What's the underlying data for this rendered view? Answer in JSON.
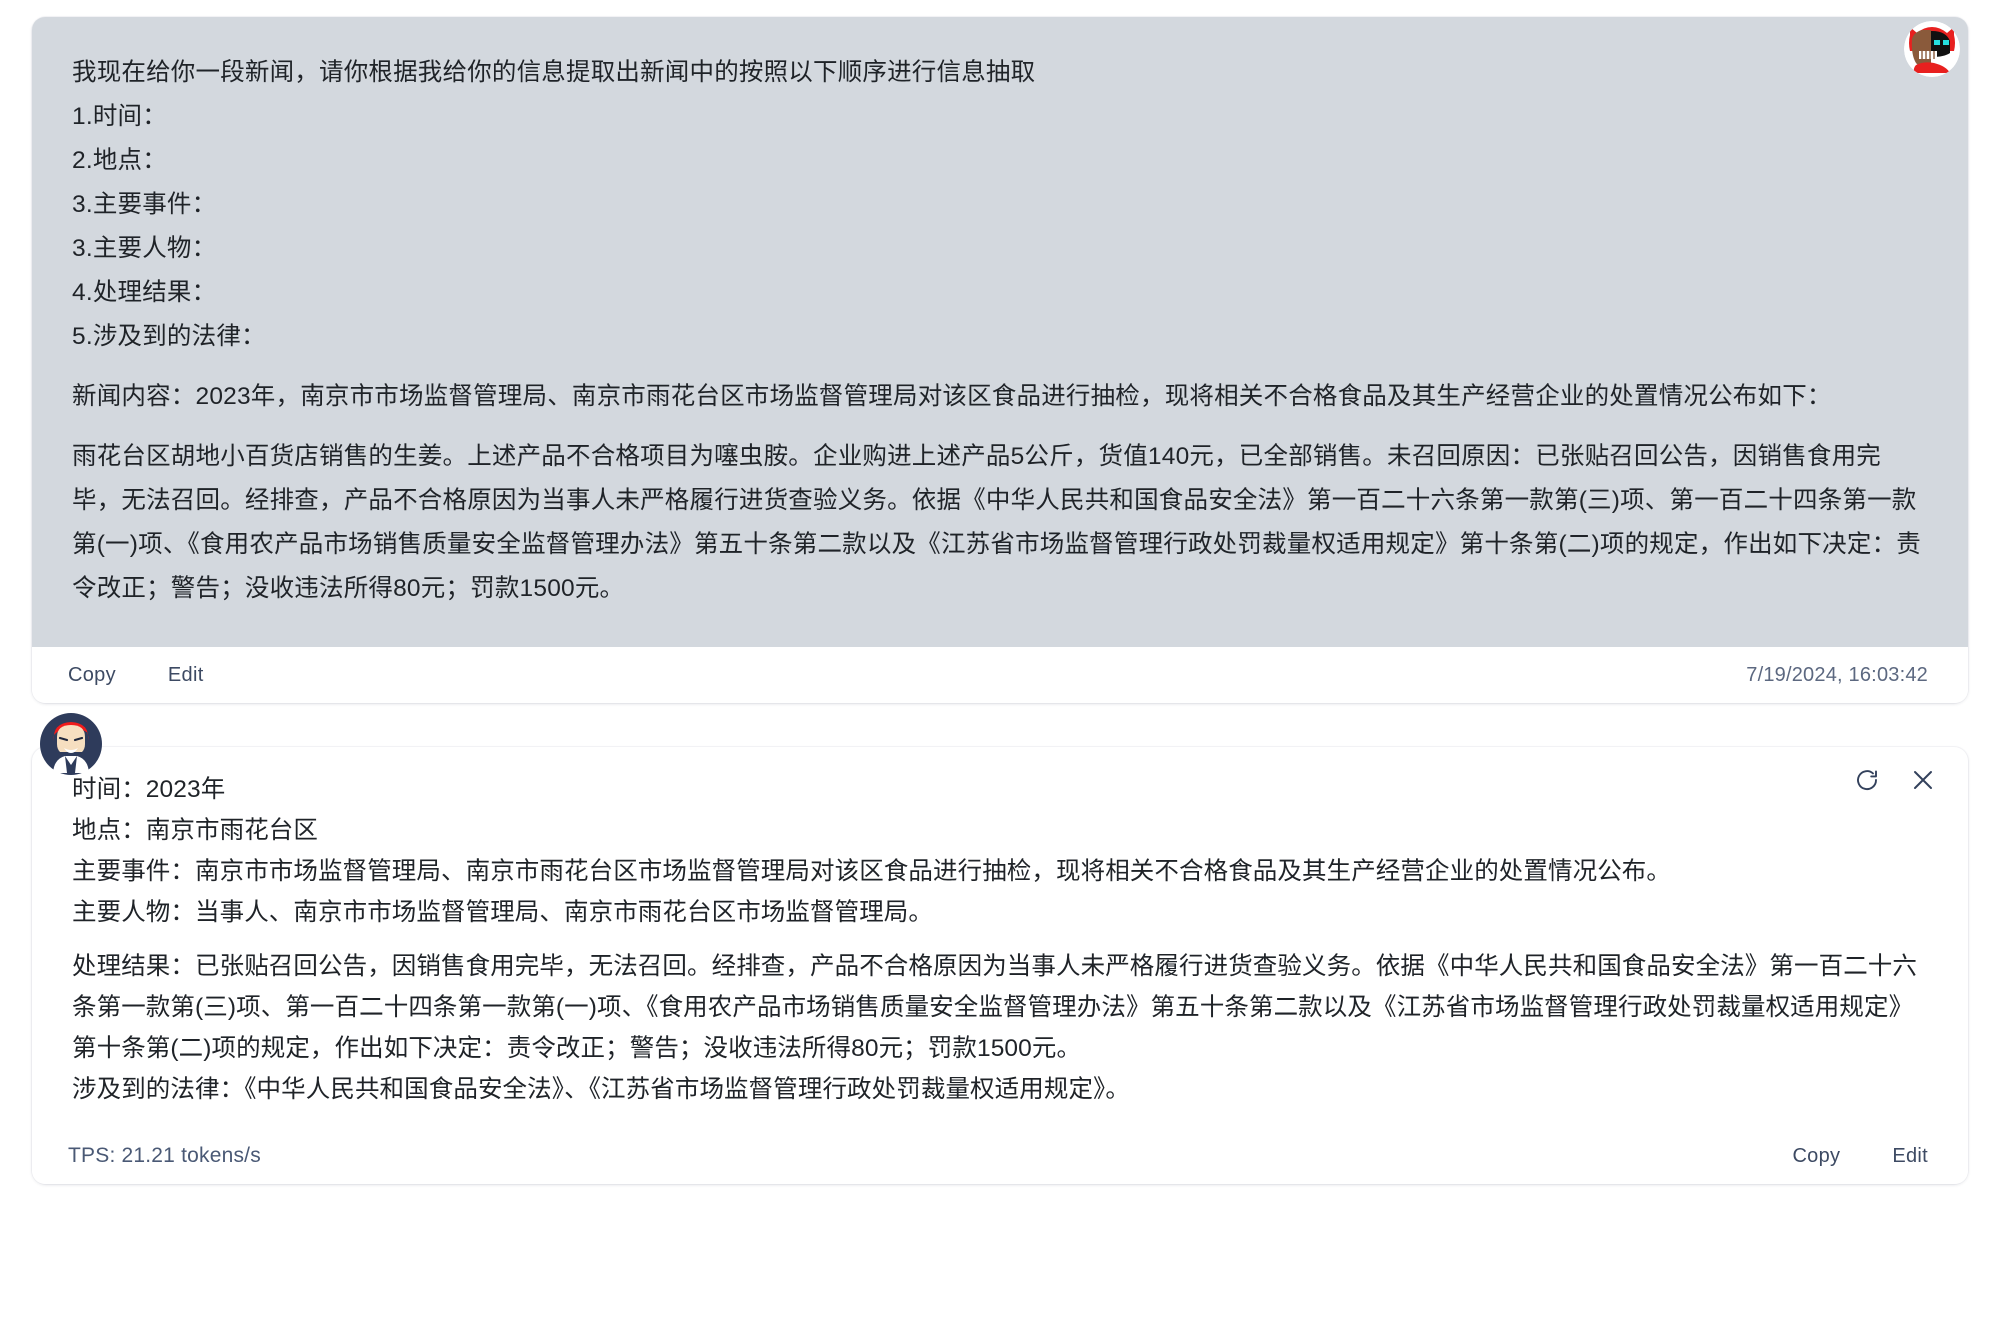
{
  "user_message": {
    "avatar_name": "user-avatar",
    "lines": [
      "我现在给你一段新闻，请你根据我给你的信息提取出新闻中的按照以下顺序进行信息抽取",
      "1.时间：",
      "2.地点：",
      "3.主要事件：",
      "3.主要人物：",
      "4.处理结果：",
      "5.涉及到的法律："
    ],
    "paragraphs": [
      "新闻内容：2023年，南京市市场监督管理局、南京市雨花台区市场监督管理局对该区食品进行抽检，现将相关不合格食品及其生产经营企业的处置情况公布如下：",
      "雨花台区胡地小百货店销售的生姜。上述产品不合格项目为噻虫胺。企业购进上述产品5公斤，货值140元，已全部销售。未召回原因：已张贴召回公告，因销售食用完毕，无法召回。经排查，产品不合格原因为当事人未严格履行进货查验义务。依据《中华人民共和国食品安全法》第一百二十六条第一款第(三)项、第一百二十四条第一款第(一)项、《食用农产品市场销售质量安全监督管理办法》第五十条第二款以及《江苏省市场监督管理行政处罚裁量权适用规定》第十条第(二)项的规定，作出如下决定：责令改正；警告；没收违法所得80元；罚款1500元。"
    ],
    "footer": {
      "copy_label": "Copy",
      "edit_label": "Edit",
      "timestamp": "7/19/2024, 16:03:42"
    }
  },
  "assistant_message": {
    "avatar_name": "assistant-avatar",
    "actions": {
      "regenerate_icon": "refresh-icon",
      "close_icon": "close-icon"
    },
    "lines": [
      "时间：2023年",
      "地点：南京市雨花台区",
      "主要事件：南京市市场监督管理局、南京市雨花台区市场监督管理局对该区食品进行抽检，现将相关不合格食品及其生产经营企业的处置情况公布。",
      "主要人物：当事人、南京市市场监督管理局、南京市雨花台区市场监督管理局。"
    ],
    "paragraphs": [
      "处理结果：已张贴召回公告，因销售食用完毕，无法召回。经排查，产品不合格原因为当事人未严格履行进货查验义务。依据《中华人民共和国食品安全法》第一百二十六条第一款第(三)项、第一百二十四条第一款第(一)项、《食用农产品市场销售质量安全监督管理办法》第五十条第二款以及《江苏省市场监督管理行政处罚裁量权适用规定》第十条第(二)项的规定，作出如下决定：责令改正；警告；没收违法所得80元；罚款1500元。"
    ],
    "trailing_lines": [
      "涉及到的法律：《中华人民共和国食品安全法》、《江苏省市场监督管理行政处罚裁量权适用规定》。"
    ],
    "footer": {
      "tps": "TPS: 21.21 tokens/s",
      "copy_label": "Copy",
      "edit_label": "Edit"
    }
  },
  "colors": {
    "user_bubble": "#d3d8de",
    "page_background": "#ffffff",
    "link_text": "#3d4a63",
    "body_text": "#1f2328",
    "avatar_red": "#e8201f",
    "avatar_navy": "#2e3b5b"
  }
}
